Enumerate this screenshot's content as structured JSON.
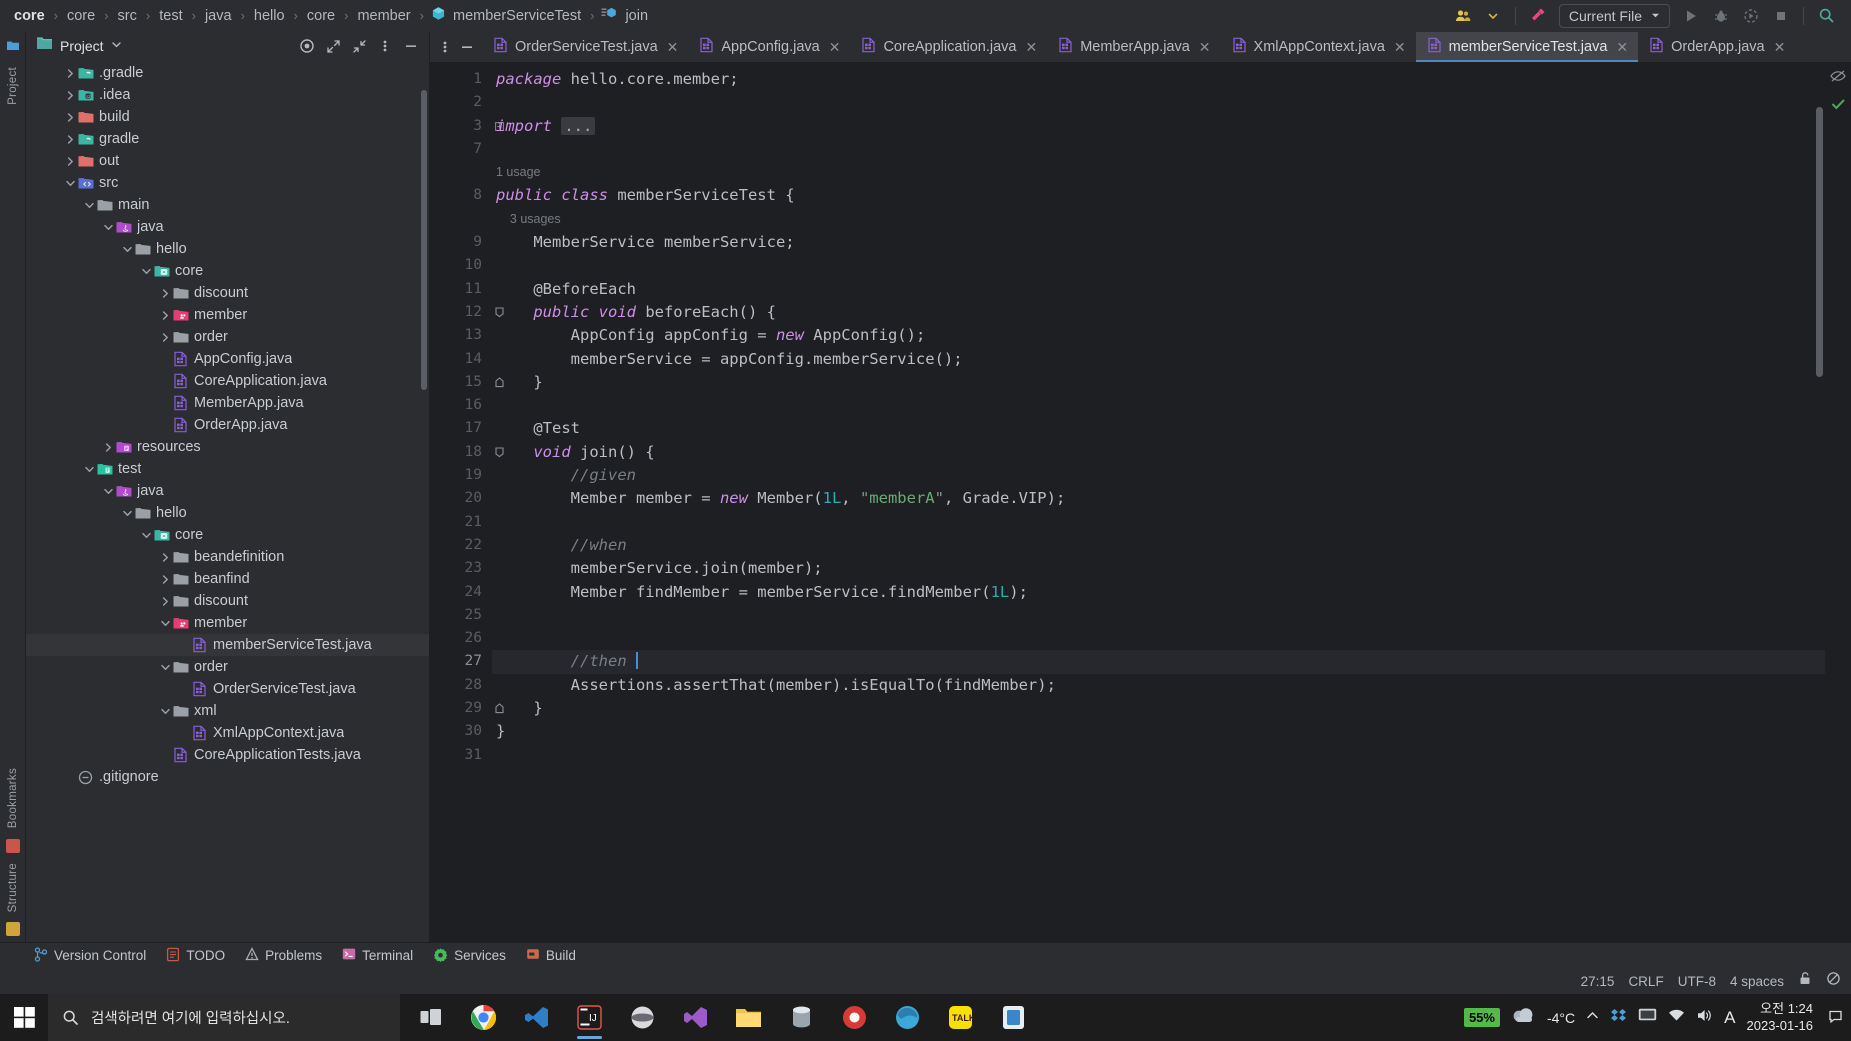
{
  "breadcrumb": {
    "items": [
      {
        "label": "core",
        "bold": true,
        "icon": null
      },
      {
        "label": "core",
        "bold": false,
        "icon": null
      },
      {
        "label": "src",
        "bold": false,
        "icon": null
      },
      {
        "label": "test",
        "bold": false,
        "icon": null
      },
      {
        "label": "java",
        "bold": false,
        "icon": null
      },
      {
        "label": "hello",
        "bold": false,
        "icon": null
      },
      {
        "label": "core",
        "bold": false,
        "icon": null
      },
      {
        "label": "member",
        "bold": false,
        "icon": null
      },
      {
        "label": "memberServiceTest",
        "bold": false,
        "icon": "class-icon"
      },
      {
        "label": "join",
        "bold": false,
        "icon": "method-icon"
      }
    ]
  },
  "toolbar": {
    "run_config_label": "Current File",
    "icons": [
      "account-icon",
      "chevron-down-icon",
      "build-hammer-icon",
      "run-icon",
      "debug-icon",
      "run-coverage-icon",
      "stop-icon",
      "search-everywhere-icon"
    ]
  },
  "project_panel": {
    "title": "Project",
    "actions": [
      "locate-target-icon",
      "expand-icon",
      "collapse-icon",
      "more-options-icon",
      "hide-icon"
    ],
    "tree": [
      {
        "depth": 1,
        "label": ".gradle",
        "chev": "right",
        "icon": "gradle-folder",
        "selected": false
      },
      {
        "depth": 1,
        "label": ".idea",
        "chev": "right",
        "icon": "idea-folder",
        "selected": false
      },
      {
        "depth": 1,
        "label": "build",
        "chev": "right",
        "icon": "build-folder",
        "selected": false
      },
      {
        "depth": 1,
        "label": "gradle",
        "chev": "right",
        "icon": "gradle-folder",
        "selected": false
      },
      {
        "depth": 1,
        "label": "out",
        "chev": "right",
        "icon": "build-folder",
        "selected": false
      },
      {
        "depth": 1,
        "label": "src",
        "chev": "down",
        "icon": "src-folder",
        "selected": false
      },
      {
        "depth": 2,
        "label": "main",
        "chev": "down",
        "icon": "plain-folder",
        "selected": false
      },
      {
        "depth": 3,
        "label": "java",
        "chev": "down",
        "icon": "java-source",
        "selected": false
      },
      {
        "depth": 4,
        "label": "hello",
        "chev": "down",
        "icon": "plain-folder",
        "selected": false
      },
      {
        "depth": 5,
        "label": "core",
        "chev": "down",
        "icon": "package-folder",
        "selected": false
      },
      {
        "depth": 6,
        "label": "discount",
        "chev": "right",
        "icon": "plain-folder",
        "selected": false
      },
      {
        "depth": 6,
        "label": "member",
        "chev": "right",
        "icon": "member-folder",
        "selected": false
      },
      {
        "depth": 6,
        "label": "order",
        "chev": "right",
        "icon": "plain-folder",
        "selected": false
      },
      {
        "depth": 6,
        "label": "AppConfig.java",
        "chev": "none",
        "icon": "java-file",
        "selected": false
      },
      {
        "depth": 6,
        "label": "CoreApplication.java",
        "chev": "none",
        "icon": "java-file",
        "selected": false
      },
      {
        "depth": 6,
        "label": "MemberApp.java",
        "chev": "none",
        "icon": "java-file",
        "selected": false
      },
      {
        "depth": 6,
        "label": "OrderApp.java",
        "chev": "none",
        "icon": "java-file",
        "selected": false
      },
      {
        "depth": 3,
        "label": "resources",
        "chev": "right",
        "icon": "resources-folder",
        "selected": false
      },
      {
        "depth": 2,
        "label": "test",
        "chev": "down",
        "icon": "test-folder",
        "selected": false
      },
      {
        "depth": 3,
        "label": "java",
        "chev": "down",
        "icon": "java-source",
        "selected": false
      },
      {
        "depth": 4,
        "label": "hello",
        "chev": "down",
        "icon": "plain-folder",
        "selected": false
      },
      {
        "depth": 5,
        "label": "core",
        "chev": "down",
        "icon": "package-folder",
        "selected": false
      },
      {
        "depth": 6,
        "label": "beandefinition",
        "chev": "right",
        "icon": "plain-folder",
        "selected": false
      },
      {
        "depth": 6,
        "label": "beanfind",
        "chev": "right",
        "icon": "plain-folder",
        "selected": false
      },
      {
        "depth": 6,
        "label": "discount",
        "chev": "right",
        "icon": "plain-folder",
        "selected": false
      },
      {
        "depth": 6,
        "label": "member",
        "chev": "down",
        "icon": "member-folder",
        "selected": false
      },
      {
        "depth": 7,
        "label": "memberServiceTest.java",
        "chev": "none",
        "icon": "java-file",
        "selected": true
      },
      {
        "depth": 6,
        "label": "order",
        "chev": "down",
        "icon": "plain-folder",
        "selected": false
      },
      {
        "depth": 7,
        "label": "OrderServiceTest.java",
        "chev": "none",
        "icon": "java-file",
        "selected": false
      },
      {
        "depth": 6,
        "label": "xml",
        "chev": "down",
        "icon": "plain-folder",
        "selected": false
      },
      {
        "depth": 7,
        "label": "XmlAppContext.java",
        "chev": "none",
        "icon": "java-file",
        "selected": false
      },
      {
        "depth": 6,
        "label": "CoreApplicationTests.java",
        "chev": "none",
        "icon": "java-file",
        "selected": false
      },
      {
        "depth": 1,
        "label": ".gitignore",
        "chev": "none",
        "icon": "gitignore-file",
        "selected": false
      }
    ]
  },
  "editor_tabs": [
    {
      "label": "OrderServiceTest.java",
      "active": false
    },
    {
      "label": "AppConfig.java",
      "active": false
    },
    {
      "label": "CoreApplication.java",
      "active": false
    },
    {
      "label": "MemberApp.java",
      "active": false
    },
    {
      "label": "XmlAppContext.java",
      "active": false
    },
    {
      "label": "memberServiceTest.java",
      "active": true
    },
    {
      "label": "OrderApp.java",
      "active": false
    }
  ],
  "code": {
    "gutter": [
      "1",
      "2",
      "3",
      "7",
      "",
      "8",
      "",
      "9",
      "10",
      "11",
      "12",
      "13",
      "14",
      "15",
      "16",
      "17",
      "18",
      "19",
      "20",
      "21",
      "22",
      "23",
      "24",
      "25",
      "26",
      "27",
      "28",
      "29",
      "30",
      "31"
    ],
    "lines": [
      {
        "n": "1",
        "type": "code",
        "html": "<span class='kw'>package</span> hello.core.member;"
      },
      {
        "n": "2",
        "type": "code",
        "html": ""
      },
      {
        "n": "3",
        "type": "code",
        "html": "<span class='kw'>import</span> <span class='dots'>...</span>",
        "fold": "plus"
      },
      {
        "n": "7",
        "type": "code",
        "html": ""
      },
      {
        "n": "",
        "type": "hint",
        "html": "1 usage"
      },
      {
        "n": "8",
        "type": "code",
        "html": "<span class='kw'>public class</span> memberServiceTest {"
      },
      {
        "n": "",
        "type": "hint",
        "html": "    3 usages"
      },
      {
        "n": "9",
        "type": "code",
        "html": "    MemberService memberService;"
      },
      {
        "n": "10",
        "type": "code",
        "html": ""
      },
      {
        "n": "11",
        "type": "code",
        "html": "    <span class='ann'>@BeforeEach</span>"
      },
      {
        "n": "12",
        "type": "code",
        "html": "    <span class='kw'>public void</span> beforeEach() {",
        "fold": "open"
      },
      {
        "n": "13",
        "type": "code",
        "html": "        AppConfig appConfig = <span class='kw'>new</span> AppConfig();"
      },
      {
        "n": "14",
        "type": "code",
        "html": "        memberService = appConfig.memberService();"
      },
      {
        "n": "15",
        "type": "code",
        "html": "    }",
        "fold": "close"
      },
      {
        "n": "16",
        "type": "code",
        "html": ""
      },
      {
        "n": "17",
        "type": "code",
        "html": "    <span class='ann'>@Test</span>"
      },
      {
        "n": "18",
        "type": "code",
        "html": "    <span class='kw'>void</span> join() {",
        "fold": "open"
      },
      {
        "n": "19",
        "type": "code",
        "html": "        <span class='cmt'>//given</span>"
      },
      {
        "n": "20",
        "type": "code",
        "html": "        Member member = <span class='kw'>new</span> Member(<span class='num'>1L</span>, <span class='str'>\"memberA\"</span>, Grade.VIP);"
      },
      {
        "n": "21",
        "type": "code",
        "html": ""
      },
      {
        "n": "22",
        "type": "code",
        "html": "        <span class='cmt'>//when</span>"
      },
      {
        "n": "23",
        "type": "code",
        "html": "        memberService.join(member);"
      },
      {
        "n": "24",
        "type": "code",
        "html": "        Member findMember = memberService.findMember(<span class='num'>1L</span>);"
      },
      {
        "n": "25",
        "type": "code",
        "html": ""
      },
      {
        "n": "26",
        "type": "code",
        "html": ""
      },
      {
        "n": "27",
        "type": "code",
        "html": "        <span class='cmt'>//then</span> <span class='caret'></span>",
        "current": true
      },
      {
        "n": "28",
        "type": "code",
        "html": "        Assertions.assertThat(member).isEqualTo(findMember);"
      },
      {
        "n": "29",
        "type": "code",
        "html": "    }",
        "fold": "close"
      },
      {
        "n": "30",
        "type": "code",
        "html": "}"
      },
      {
        "n": "31",
        "type": "code",
        "html": ""
      }
    ]
  },
  "tool_windows": [
    {
      "label": "Version Control",
      "icon": "branch-icon"
    },
    {
      "label": "TODO",
      "icon": "todo-icon"
    },
    {
      "label": "Problems",
      "icon": "problems-icon"
    },
    {
      "label": "Terminal",
      "icon": "terminal-icon"
    },
    {
      "label": "Services",
      "icon": "services-icon"
    },
    {
      "label": "Build",
      "icon": "build-icon"
    }
  ],
  "status_bar": {
    "caret_position": "27:15",
    "line_separator": "CRLF",
    "encoding": "UTF-8",
    "indent": "4 spaces",
    "icons": [
      "lock-icon",
      "inspection-icon"
    ]
  },
  "taskbar": {
    "search_placeholder": "검색하려면 여기에 입력하십시오.",
    "battery_percent": "55%",
    "temperature": "-4°C",
    "clock_time": "오전 1:24",
    "clock_date": "2023-01-16",
    "apps": [
      "task-view-icon",
      "chrome-icon",
      "vscode-icon",
      "intellij-icon",
      "ubuntu-icon",
      "vs-icon",
      "explorer-icon",
      "mysql-icon",
      "record-icon",
      "edge-icon",
      "kakaotalk-icon",
      "app-icon"
    ]
  },
  "left_rail": {
    "top_labels": [
      "Project"
    ],
    "bottom_labels": [
      "Bookmarks",
      "Structure"
    ]
  },
  "colors": {
    "background": "#2b2d30",
    "editor_bg": "#1e1f22",
    "accent": "#4a88c7",
    "keyword": "#cf8ee8",
    "string": "#6aab73",
    "number": "#2aacb8",
    "comment": "#7a7e85",
    "selection": "#343538"
  }
}
